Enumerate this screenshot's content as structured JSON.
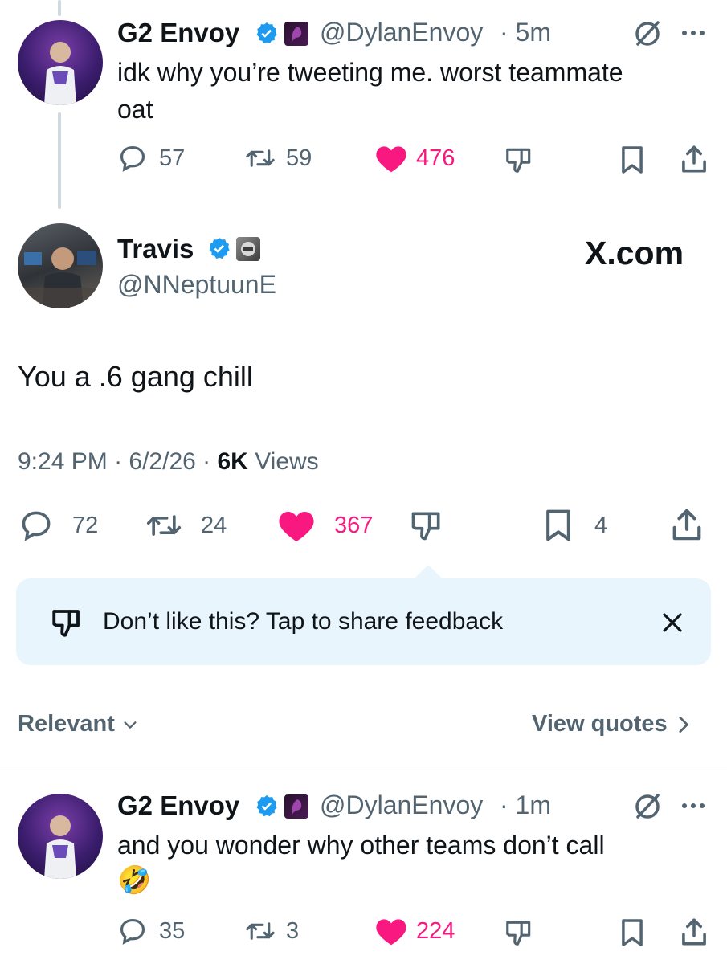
{
  "reply_top": {
    "name": "G2 Envoy",
    "handle": "@DylanEnvoy",
    "time": "· 5m",
    "text_line1": "idk why you’re tweeting me. worst teammate",
    "text_line2": "oat",
    "replies": "57",
    "reposts": "59",
    "likes": "476"
  },
  "main_tweet": {
    "name": "Travis",
    "handle": "@NNeptuunE",
    "watermark": "X.com",
    "text": "You a .6 gang chill",
    "time": "9:24 PM",
    "date": "6/2/26",
    "views_count": "6K",
    "views_label": "Views",
    "replies": "72",
    "reposts": "24",
    "likes": "367",
    "bookmarks": "4"
  },
  "feedback": {
    "text": "Don’t like this? Tap to share feedback"
  },
  "sort_bar": {
    "relevant_label": "Relevant",
    "view_quotes_label": "View quotes"
  },
  "reply_bottom": {
    "name": "G2 Envoy",
    "handle": "@DylanEnvoy",
    "time": "· 1m",
    "text_line1": "and you wonder why other teams don’t call",
    "emoji": "🤣",
    "replies": "35",
    "reposts": "3",
    "likes": "224"
  },
  "colors": {
    "accent_like": "#f91880",
    "verified": "#1d9bf0",
    "secondary_text": "#536471",
    "feedback_bg": "#e8f5fd"
  },
  "icons": [
    "verified-icon",
    "grok-icon",
    "more-icon",
    "reply-icon",
    "repost-icon",
    "like-icon",
    "dislike-icon",
    "bookmark-icon",
    "share-icon",
    "close-icon",
    "chevron-down-icon",
    "chevron-right-icon"
  ]
}
